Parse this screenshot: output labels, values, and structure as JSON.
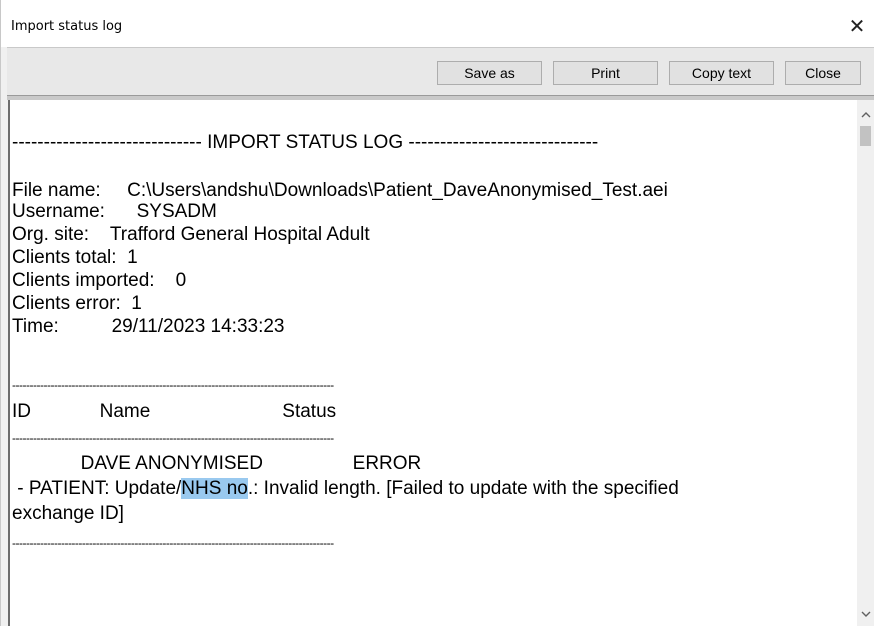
{
  "window": {
    "title": "Import status log",
    "close_glyph": "✕"
  },
  "toolbar": {
    "save_as": "Save as",
    "print": "Print",
    "copy_text": "Copy text",
    "close": "Close"
  },
  "log": {
    "header": "------------------------------ IMPORT STATUS LOG ------------------------------",
    "file_name": "File name:     C:\\Users\\andshu\\Downloads\\Patient_DaveAnonymised_Test.aei",
    "username": "Username:      SYSADM",
    "org_site": "Org. site:    Trafford General Hospital Adult",
    "clients_total": "Clients total:  1",
    "clients_imported": "Clients imported:    0",
    "clients_error": "Clients error:  1",
    "time": "Time:          29/11/2023 14:33:23",
    "separator": "--------------------------------------------------------------------------------------------",
    "col_header": "ID             Name                         Status",
    "row_name": "             DAVE ANONYMISED                 ERROR",
    "error_prefix": " - PATIENT: Update/",
    "error_highlight": "NHS no",
    "error_suffix": ".: Invalid length. [Failed to update with the specified",
    "error_line2": "exchange ID]"
  },
  "scrollbar": {
    "up_icon": "chevron-up",
    "down_icon": "chevron-down"
  }
}
